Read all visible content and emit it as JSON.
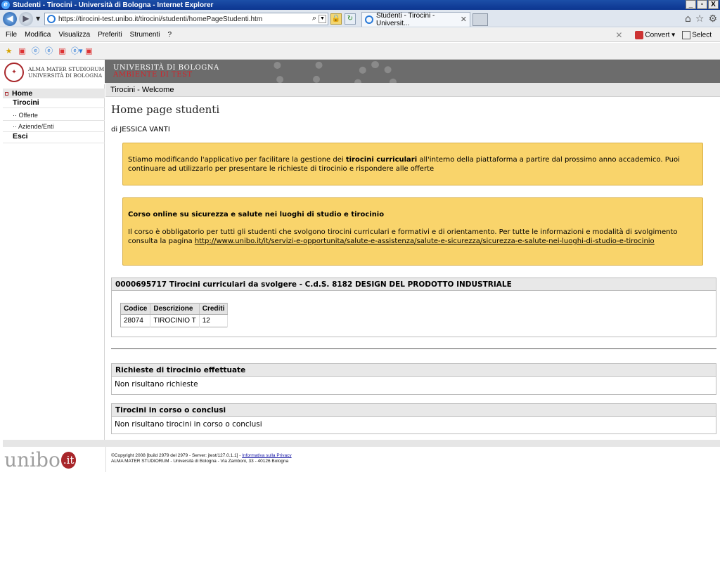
{
  "browser": {
    "window_title": "Studenti - Tirocini - Università di Bologna - Internet Explorer",
    "window_controls": [
      "_",
      "▫",
      "X"
    ],
    "url": "https://tirocini-test.unibo.it/tirocini/studenti/homePageStudenti.htm",
    "tab_title": "Studenti - Tirocini - Universit...",
    "menu": [
      "File",
      "Modifica",
      "Visualizza",
      "Preferiti",
      "Strumenti",
      "?"
    ],
    "convert_label": "Convert",
    "select_label": "Select"
  },
  "header": {
    "alma_line1": "Alma Mater Studiorum",
    "alma_line2": "Università di Bologna",
    "university": "UNIVERSITÀ DI BOLOGNA",
    "environment": "AMBIENTE DI TEST"
  },
  "sidebar": {
    "home": "Home",
    "tirocini": "Tirocini",
    "offerte": "·· Offerte",
    "aziende": "·· Aziende/Enti",
    "esci": "Esci"
  },
  "breadcrumb": "Tirocini - Welcome",
  "main": {
    "title": "Home page studenti",
    "author": "di JESSICA VANTI",
    "notice1_part1": "Stiamo modificando l'applicativo per facilitare la gestione dei ",
    "notice1_bold": "tirocini curriculari",
    "notice1_part2": " all'interno della piattaforma a partire dal prossimo anno accademico. Puoi continuare ad utilizzarlo per presentare le richieste di tirocinio e rispondere alle offerte",
    "notice2_title": "Corso online su sicurezza e salute nei luoghi di studio e tirocinio",
    "notice2_text": "Il corso è obbligatorio per tutti gli studenti che svolgono tirocini curriculari e formativi e di orientamento. Per tutte le informazioni e modalità di svolgimento consulta la pagina ",
    "notice2_link": "http://www.unibo.it/it/servizi-e-opportunita/salute-e-assistenza/salute-e-sicurezza/sicurezza-e-salute-nei-luoghi-di-studio-e-tirocinio",
    "courses_title": "0000695717 Tirocini curriculari da svolgere - C.d.S. 8182 DESIGN DEL PRODOTTO INDUSTRIALE",
    "table": {
      "headers": [
        "Codice",
        "Descrizione",
        "Crediti"
      ],
      "rows": [
        [
          "28074",
          "TIROCINIO T",
          "12"
        ]
      ]
    },
    "requests_title": "Richieste di tirocinio effettuate",
    "requests_text": "Non risultano richieste",
    "ongoing_title": "Tirocini in corso o conclusi",
    "ongoing_text": "Non risultano tirocini in corso o conclusi"
  },
  "footer": {
    "logo": "unibo",
    "logo_suffix": ".it",
    "copyright": "©Copyright 2008 [build 2979 del 2979 - Server: jtest/127.0.1.1] - ",
    "privacy_link": "Informativa sulla Privacy",
    "address": "ALMA MATER STUDIORUM - Università di Bologna - Via Zamboni, 33 - 40126 Bologna"
  }
}
